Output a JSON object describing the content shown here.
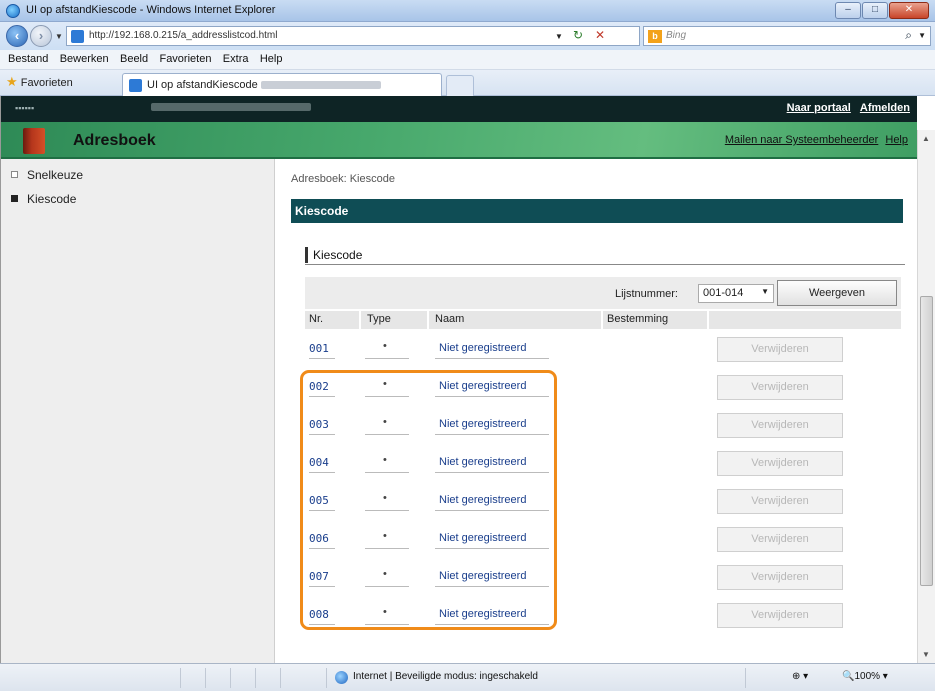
{
  "window": {
    "title": "UI op afstandKiescode",
    "title_suffix": "- Windows Internet Explorer",
    "minimize": "–",
    "maximize": "□",
    "close": "✕"
  },
  "address": {
    "url": "http://192.168.0.215/a_addresslistcod.html",
    "search_placeholder": "Bing"
  },
  "menu": [
    "Bestand",
    "Bewerken",
    "Beeld",
    "Favorieten",
    "Extra",
    "Help"
  ],
  "favorites": {
    "label": "Favorieten",
    "tab_label": "UI op afstandKiescode"
  },
  "header": {
    "portal_link": "Naar portaal",
    "logout_link": "Afmelden",
    "section_title": "Adresboek",
    "mail_link": "Mailen naar Systeembeheerder",
    "help_link": "Help"
  },
  "sidebar": {
    "items": [
      {
        "label": "Snelkeuze",
        "active": false
      },
      {
        "label": "Kiescode",
        "active": true
      }
    ]
  },
  "main": {
    "breadcrumb": "Adresboek: Kiescode",
    "section_header": "Kiescode",
    "subheader": "Kiescode",
    "list_label": "Lijstnummer:",
    "list_value": "001-014",
    "show_button": "Weergeven",
    "columns": [
      "Nr.",
      "Type",
      "Naam",
      "Bestemming"
    ],
    "rows": [
      {
        "nr": "001",
        "type": "•",
        "naam": "Niet geregistreerd",
        "delete": "Verwijderen"
      },
      {
        "nr": "002",
        "type": "•",
        "naam": "Niet geregistreerd",
        "delete": "Verwijderen"
      },
      {
        "nr": "003",
        "type": "•",
        "naam": "Niet geregistreerd",
        "delete": "Verwijderen"
      },
      {
        "nr": "004",
        "type": "•",
        "naam": "Niet geregistreerd",
        "delete": "Verwijderen"
      },
      {
        "nr": "005",
        "type": "•",
        "naam": "Niet geregistreerd",
        "delete": "Verwijderen"
      },
      {
        "nr": "006",
        "type": "•",
        "naam": "Niet geregistreerd",
        "delete": "Verwijderen"
      },
      {
        "nr": "007",
        "type": "•",
        "naam": "Niet geregistreerd",
        "delete": "Verwijderen"
      },
      {
        "nr": "008",
        "type": "•",
        "naam": "Niet geregistreerd",
        "delete": "Verwijderen"
      }
    ]
  },
  "status": {
    "zone": "Internet | Beveiligde modus: ingeschakeld",
    "zoom": "100%"
  },
  "colors": {
    "header_green": "#47a86c",
    "section_teal": "#0f4d55",
    "highlight_orange": "#f08b19",
    "link_blue": "#1a3e8c"
  }
}
